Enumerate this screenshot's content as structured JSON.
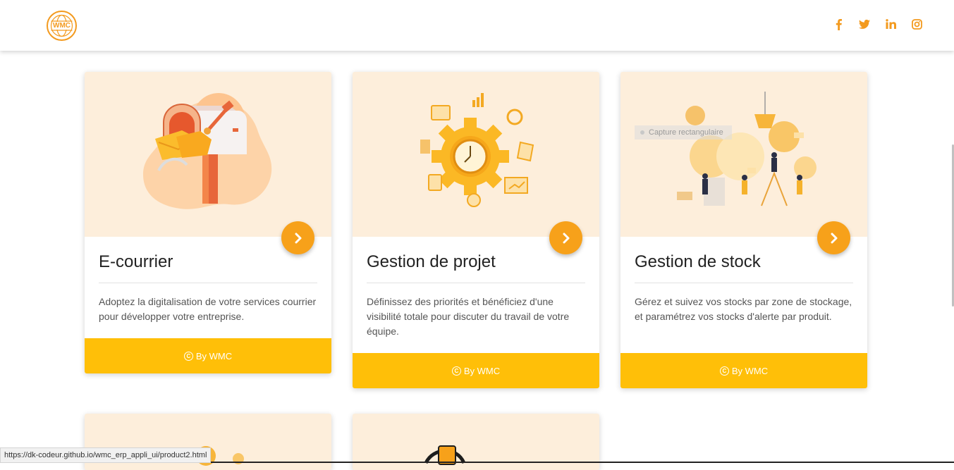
{
  "header": {
    "logo_text": "WMC",
    "socials": [
      {
        "icon": "facebook-icon",
        "glyph": "f"
      },
      {
        "icon": "twitter-icon",
        "glyph": "t"
      },
      {
        "icon": "linkedin-icon",
        "glyph": "in"
      },
      {
        "icon": "instagram-icon",
        "glyph": "ig"
      }
    ]
  },
  "colors": {
    "accent": "#f7a11a",
    "footer": "#ffbf08",
    "image_bg": "#fdeedb"
  },
  "cards": [
    {
      "title": "E-courrier",
      "description": "Adoptez la digitalisation de votre services courrier pour développer votre entreprise.",
      "footer": "By WMC",
      "image": "mailbox-illustration"
    },
    {
      "title": "Gestion de projet",
      "description": "Définissez des priorités et bénéficiez d'une visibilité totale pour discuter du travail de votre équipe.",
      "footer": "By WMC",
      "image": "gear-clock-illustration"
    },
    {
      "title": "Gestion de stock",
      "description": "Gérez et suivez vos stocks par zone de stockage, et paramétrez vos stocks d'alerte par produit.",
      "footer": "By WMC",
      "image": "team-gears-illustration",
      "overlay": "Capture rectangulaire"
    }
  ],
  "status_url": "https://dk-codeur.github.io/wmc_erp_appli_ui/product2.html"
}
